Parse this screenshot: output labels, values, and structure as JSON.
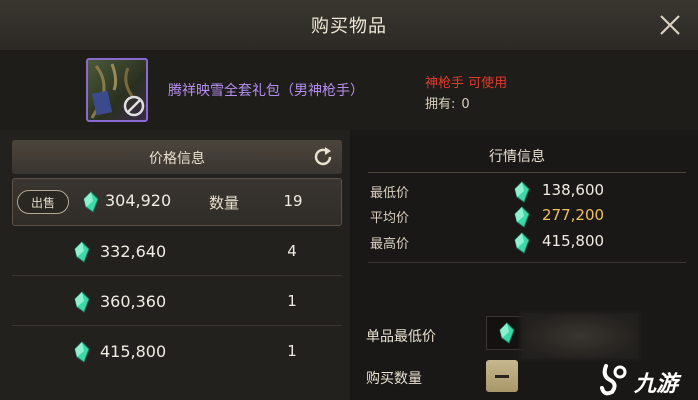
{
  "dialog": {
    "title": "购买物品"
  },
  "item": {
    "name": "腾祥映雪全套礼包（男神枪手）",
    "usable": "神枪手 可使用",
    "owned_label": "拥有:",
    "owned_value": "0"
  },
  "price_panel": {
    "header": "价格信息",
    "sell_label": "出售",
    "qty_label": "数量",
    "rows": [
      {
        "price": "304,920",
        "qty": "19"
      },
      {
        "price": "332,640",
        "qty": "4"
      },
      {
        "price": "360,360",
        "qty": "1"
      },
      {
        "price": "415,800",
        "qty": "1"
      }
    ]
  },
  "market_panel": {
    "header": "行情信息",
    "rows": [
      {
        "label": "最低价",
        "value": "138,600"
      },
      {
        "label": "平均价",
        "value": "277,200"
      },
      {
        "label": "最高价",
        "value": "415,800"
      }
    ]
  },
  "purchase": {
    "unit_min_label": "单品最低价",
    "buy_qty_label": "购买数量"
  },
  "watermark": {
    "text": "九游"
  },
  "colors": {
    "accent_purple": "#b48ef0",
    "usable_red": "#e23a2a",
    "avg_gold": "#f0c060",
    "gem_green": "#3fd8a8"
  }
}
